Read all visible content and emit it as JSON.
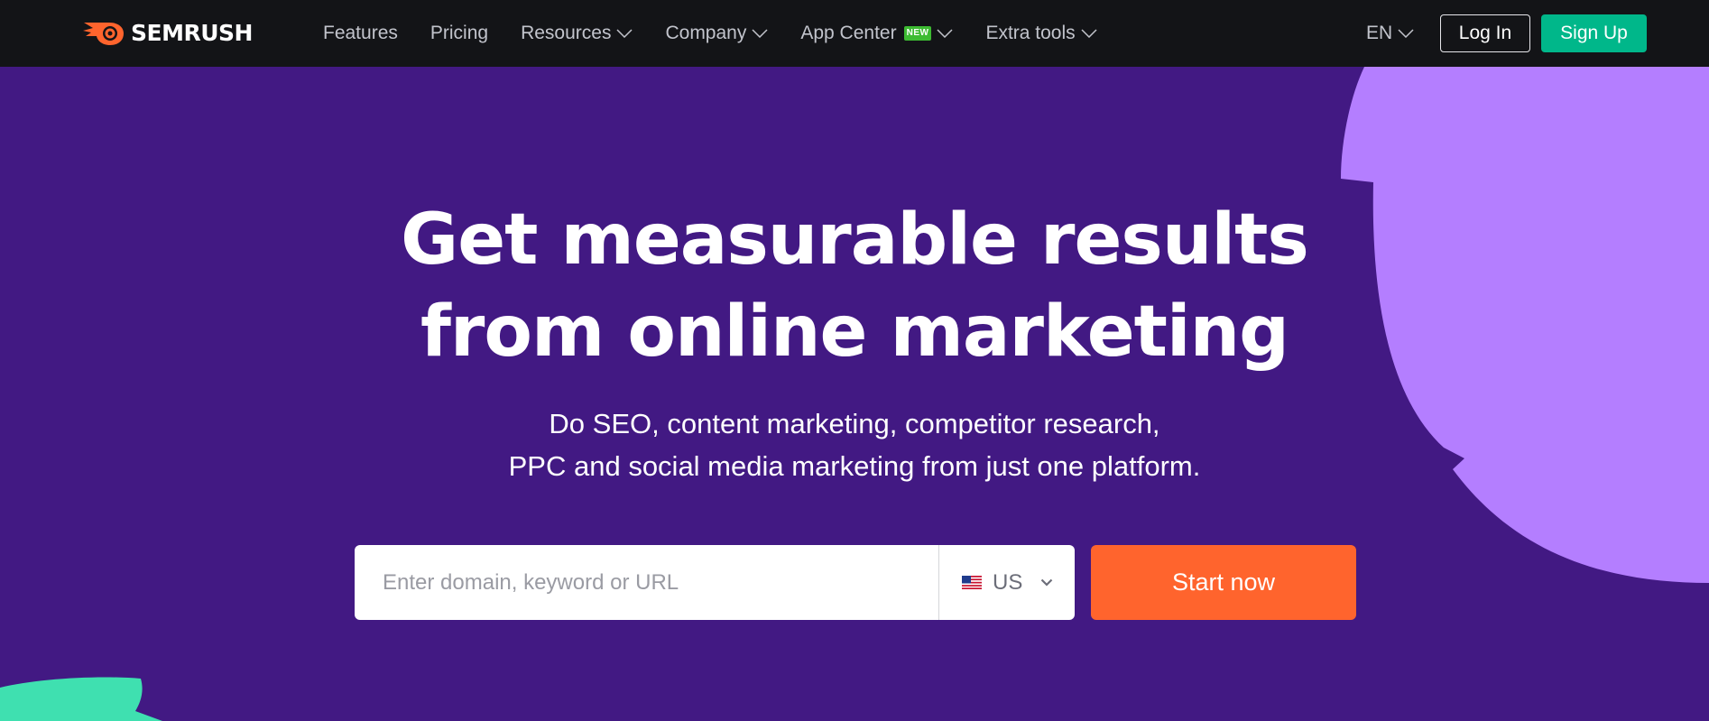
{
  "brand": {
    "name": "SEMRUSH",
    "logo_icon": "semrush-fireball-icon",
    "colors": {
      "topbar": "#131417",
      "hero_bg": "#421983",
      "accent_orange": "#ff642d",
      "accent_green": "#00b78a",
      "shape_purple": "#b47eff",
      "shape_mint": "#3fe0b0",
      "badge_green": "#3dbb32"
    }
  },
  "nav": {
    "items": [
      {
        "label": "Features",
        "has_dropdown": false
      },
      {
        "label": "Pricing",
        "has_dropdown": false
      },
      {
        "label": "Resources",
        "has_dropdown": true
      },
      {
        "label": "Company",
        "has_dropdown": true
      },
      {
        "label": "App Center",
        "badge": "NEW",
        "has_dropdown": true
      },
      {
        "label": "Extra tools",
        "has_dropdown": true
      }
    ],
    "language": "EN",
    "login_label": "Log In",
    "signup_label": "Sign Up"
  },
  "hero": {
    "title_line1": "Get measurable results",
    "title_line2": "from online marketing",
    "subtitle_line1": "Do SEO, content marketing, competitor research,",
    "subtitle_line2": "PPC and social media marketing from just one platform."
  },
  "search": {
    "placeholder": "Enter domain, keyword or URL",
    "value": "",
    "database": "US",
    "database_flag": "us-flag-icon",
    "start_label": "Start now"
  }
}
